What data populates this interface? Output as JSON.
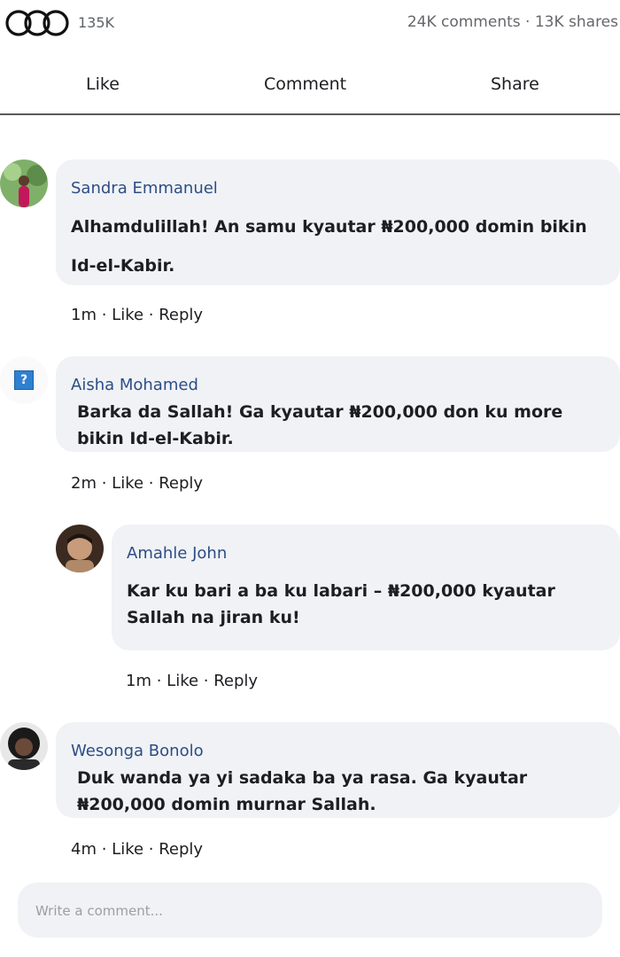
{
  "stats": {
    "reactions_count": "135K",
    "comments_shares": "24K comments · 13K shares"
  },
  "actions": {
    "like": "Like",
    "comment": "Comment",
    "share": "Share"
  },
  "comments": [
    {
      "author": "Sandra Emmanuel",
      "text": "Alhamdulillah! An samu kyautar ₦200,000 domin bikin Id-el-Kabir.",
      "time": "1m",
      "like": "Like",
      "reply": "Reply"
    },
    {
      "author": "Aisha Mohamed",
      "text": "Barka da Sallah! Ga kyautar ₦200,000 don ku more bikin Id-el-Kabir.",
      "time": "2m",
      "like": "Like",
      "reply": "Reply",
      "avatar_glyph": "?"
    },
    {
      "author": "Amahle John",
      "text": "Kar ku bari a ba ku labari – ₦200,000 kyautar Sallah na jiran ku!",
      "time": "1m",
      "like": "Like",
      "reply": "Reply"
    },
    {
      "author": "Wesonga Bonolo",
      "text": "Duk wanda ya yi sadaka ba ya rasa. Ga kyautar ₦200,000 domin murnar Sallah.",
      "time": "4m",
      "like": "Like",
      "reply": "Reply"
    }
  ],
  "composer": {
    "placeholder": "Write a comment..."
  }
}
